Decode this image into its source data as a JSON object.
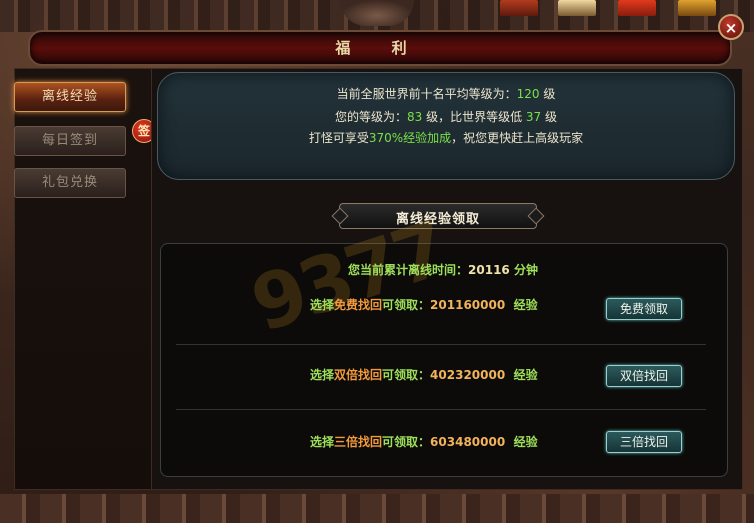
{
  "window": {
    "title": "福  利",
    "close_label": "×"
  },
  "nav": {
    "items": [
      {
        "label": "离线经验",
        "active": true
      },
      {
        "label": "每日签到",
        "active": false
      },
      {
        "label": "礼包兑换",
        "active": false
      }
    ],
    "badge": "签"
  },
  "info": {
    "line1_prefix": "当前全服世界前十名平均等级为：",
    "server_avg_level": "120",
    "line1_suffix": "级",
    "line2_prefix": "您的等级为：",
    "my_level": "83",
    "line2_mid": "级，比世界等级低",
    "level_gap": "37",
    "line2_suffix": "级",
    "line3_prefix": "打怪可享受",
    "exp_bonus": "370%经验加成",
    "line3_suffix": "，祝您更快赶上高级玩家"
  },
  "section": {
    "title": "离线经验领取"
  },
  "offline": {
    "total_prefix": "您当前累计离线时间：",
    "total_minutes": "20116",
    "total_unit": "分钟"
  },
  "options": [
    {
      "prefix": "选择",
      "option": "免费找回",
      "mid": "可领取：",
      "amount": "201160000",
      "unit": "经验",
      "button": "免费领取"
    },
    {
      "prefix": "选择",
      "option": "双倍找回",
      "mid": "可领取：",
      "amount": "402320000",
      "unit": "经验",
      "button": "双倍找回"
    },
    {
      "prefix": "选择",
      "option": "三倍找回",
      "mid": "可领取：",
      "amount": "603480000",
      "unit": "经验",
      "button": "三倍找回"
    }
  ],
  "watermark": "9377"
}
